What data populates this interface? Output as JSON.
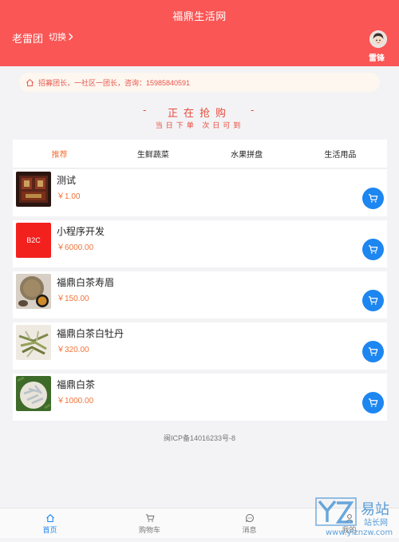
{
  "header": {
    "title": "福鼎生活网",
    "leader_name": "老雷团",
    "switch_label": "切换",
    "user_name": "雷锋"
  },
  "notice": {
    "text": "招募团长，一社区一团长，咨询：15985840591"
  },
  "rush": {
    "dash": "-",
    "title": "正在抢购",
    "subtitle": "当日下单 次日可到"
  },
  "tabs": [
    {
      "label": "推荐",
      "active": true
    },
    {
      "label": "生鲜蔬菜",
      "active": false
    },
    {
      "label": "水果拼盘",
      "active": false
    },
    {
      "label": "生活用品",
      "active": false
    }
  ],
  "products": [
    {
      "name": "测试",
      "price": "￥1.00",
      "thumb": "bookcase"
    },
    {
      "name": "小程序开发",
      "price": "￥6000.00",
      "thumb": "b2c-text",
      "thumb_text": "B2C"
    },
    {
      "name": "福鼎白茶寿眉",
      "price": "￥150.00",
      "thumb": "tea-cake"
    },
    {
      "name": "福鼎白茶白牡丹",
      "price": "￥320.00",
      "thumb": "tea-leaves"
    },
    {
      "name": "福鼎白茶",
      "price": "￥1000.00",
      "thumb": "silver-needle"
    }
  ],
  "footer": {
    "icp": "闽ICP备14016233号-8"
  },
  "tabbar": [
    {
      "label": "首页",
      "icon": "home-icon",
      "active": true
    },
    {
      "label": "购物车",
      "icon": "cart-icon",
      "active": false
    },
    {
      "label": "消息",
      "icon": "message-icon",
      "active": false
    },
    {
      "label": "我的",
      "icon": "user-icon",
      "active": false
    }
  ],
  "watermark": {
    "brand": "易站",
    "sub": "站长网",
    "url": "www.yiznzw.com"
  },
  "colors": {
    "header_bg": "#f95655",
    "accent_orange": "#f0743a",
    "accent_blue": "#1d86f0",
    "notice_text": "#e8554d"
  }
}
